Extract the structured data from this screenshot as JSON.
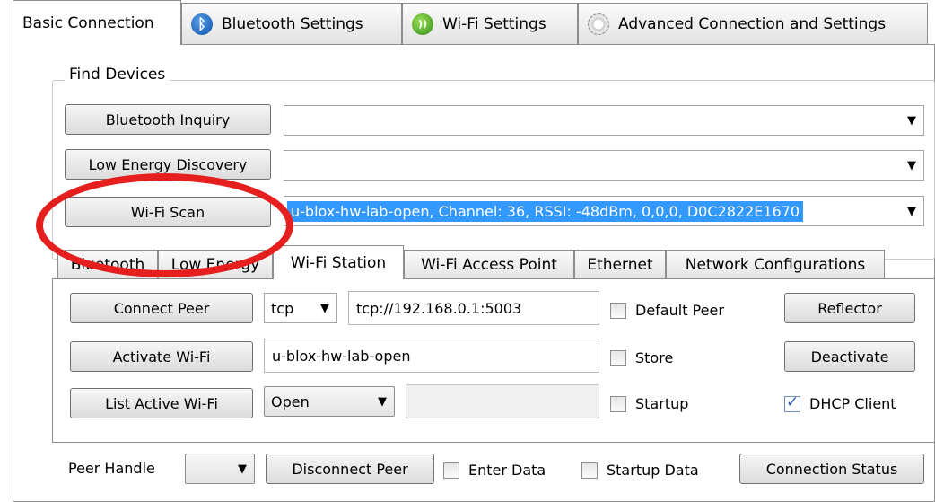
{
  "top_tabs": [
    {
      "label": "Basic Connection",
      "icon": ""
    },
    {
      "label": "Bluetooth Settings",
      "icon": "bluetooth-icon"
    },
    {
      "label": "Wi-Fi Settings",
      "icon": "wifi-icon"
    },
    {
      "label": "Advanced Connection and Settings",
      "icon": "gear-icon"
    }
  ],
  "find_devices": {
    "title": "Find Devices",
    "bluetooth_inquiry_label": "Bluetooth Inquiry",
    "bluetooth_inquiry_value": "",
    "low_energy_label": "Low Energy Discovery",
    "low_energy_value": "",
    "wifi_scan_label": "Wi-Fi Scan",
    "wifi_scan_value": "u-blox-hw-lab-open, Channel: 36, RSSI: -48dBm, 0,0,0, D0C2822E1670"
  },
  "inner_tabs": [
    "Bluetooth",
    "Low Energy",
    "Wi-Fi Station",
    "Wi-Fi Access Point",
    "Ethernet",
    "Network Configurations"
  ],
  "wifi_station": {
    "connect_peer_label": "Connect Peer",
    "protocol": "tcp",
    "peer_url": "tcp://192.168.0.1:5003",
    "default_peer_label": "Default Peer",
    "reflector_label": "Reflector",
    "activate_wifi_label": "Activate Wi-Fi",
    "ssid": "u-blox-hw-lab-open",
    "store_label": "Store",
    "deactivate_label": "Deactivate",
    "list_active_label": "List Active Wi-Fi",
    "security": "Open",
    "password": "",
    "startup_label": "Startup",
    "dhcp_label": "DHCP Client",
    "dhcp_checked": true
  },
  "bottom": {
    "peer_handle_label": "Peer Handle",
    "peer_handle_value": "",
    "disconnect_label": "Disconnect Peer",
    "enter_data_label": "Enter Data",
    "startup_data_label": "Startup Data",
    "connection_status_label": "Connection Status"
  },
  "colors": {
    "selection": "#3399ff",
    "annotation": "#e51e1e"
  }
}
